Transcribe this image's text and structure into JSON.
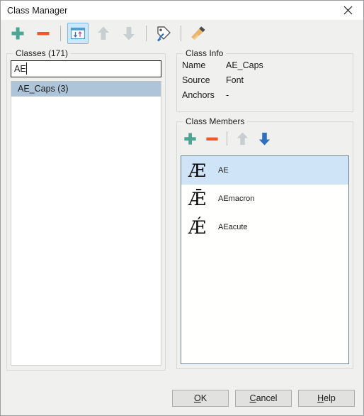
{
  "window": {
    "title": "Class Manager",
    "close_icon": "close-icon"
  },
  "toolbar": {
    "items": [
      {
        "name": "add-class-button",
        "icon": "plus-icon",
        "state": "enabled"
      },
      {
        "name": "remove-class-button",
        "icon": "minus-icon",
        "state": "enabled"
      },
      {
        "name": "toolbar-separator-1",
        "icon": "separator",
        "state": "static"
      },
      {
        "name": "sort-toggle-button",
        "icon": "sort-updown-icon",
        "state": "active"
      },
      {
        "name": "move-up-button",
        "icon": "arrow-up-icon",
        "state": "disabled"
      },
      {
        "name": "move-down-button",
        "icon": "arrow-down-icon",
        "state": "disabled"
      },
      {
        "name": "toolbar-separator-2",
        "icon": "separator",
        "state": "static"
      },
      {
        "name": "rename-class-button",
        "icon": "tag-pen-icon",
        "state": "enabled"
      },
      {
        "name": "toolbar-separator-3",
        "icon": "separator",
        "state": "static"
      },
      {
        "name": "clean-up-button",
        "icon": "brush-icon",
        "state": "enabled"
      }
    ]
  },
  "classes_panel": {
    "title": "Classes (171)",
    "search": {
      "value": "AE",
      "placeholder": ""
    },
    "items": [
      {
        "label": "AE_Caps (3)",
        "selected": true
      }
    ]
  },
  "class_info": {
    "title": "Class Info",
    "rows": [
      {
        "label": "Name",
        "value": "AE_Caps"
      },
      {
        "label": "Source",
        "value": "Font"
      },
      {
        "label": "Anchors",
        "value": "-"
      }
    ]
  },
  "class_members": {
    "title": "Class Members",
    "toolbar": [
      {
        "name": "add-member-button",
        "icon": "plus-icon",
        "state": "enabled"
      },
      {
        "name": "remove-member-button",
        "icon": "minus-icon",
        "state": "enabled"
      },
      {
        "name": "members-separator-1",
        "icon": "separator",
        "state": "static"
      },
      {
        "name": "member-move-up-button",
        "icon": "arrow-up-icon",
        "state": "disabled"
      },
      {
        "name": "member-move-down-button",
        "icon": "arrow-down-icon",
        "state": "enabled"
      }
    ],
    "items": [
      {
        "glyph": "Æ",
        "label": "AE",
        "selected": true
      },
      {
        "glyph": "Ǣ",
        "label": "AEmacron",
        "selected": false
      },
      {
        "glyph": "Ǽ",
        "label": "AEacute",
        "selected": false
      }
    ]
  },
  "footer": {
    "ok": {
      "accel": "O",
      "rest": "K"
    },
    "cancel": {
      "accel": "C",
      "rest": "ancel"
    },
    "help": {
      "accel": "H",
      "rest": "elp"
    }
  },
  "colors": {
    "accent_green": "#4ca693",
    "accent_orange": "#f0582a",
    "accent_blue": "#2f6fc0",
    "disabled_gray": "#c4c9cc",
    "selection_class": "#adc4d9",
    "selection_member": "#cfe4f7",
    "toolbar_bg": "#f0f0ee"
  }
}
